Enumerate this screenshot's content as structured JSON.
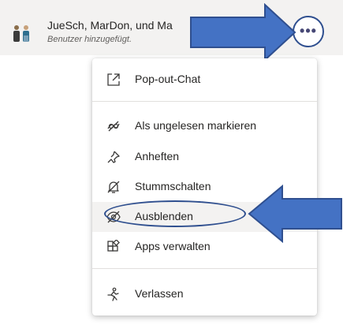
{
  "chat": {
    "title": "JueSch, MarDon, und Ma",
    "subtitle": "Benutzer hinzugefügt."
  },
  "menu": {
    "items": [
      {
        "label": "Pop-out-Chat",
        "icon": "popout-icon"
      },
      {
        "label": "Als ungelesen markieren",
        "icon": "mark-unread-icon"
      },
      {
        "label": "Anheften",
        "icon": "pin-icon"
      },
      {
        "label": "Stummschalten",
        "icon": "mute-icon"
      },
      {
        "label": "Ausblenden",
        "icon": "hide-icon",
        "highlighted": true
      },
      {
        "label": "Apps verwalten",
        "icon": "apps-icon"
      },
      {
        "label": "Verlassen",
        "icon": "leave-icon"
      }
    ]
  },
  "colors": {
    "arrow_fill": "#4472c4",
    "arrow_stroke": "#2f4f8f",
    "accent": "#464775"
  }
}
